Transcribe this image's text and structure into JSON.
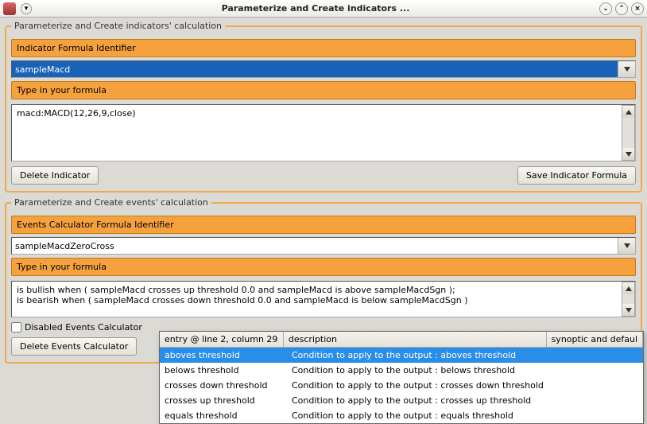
{
  "window": {
    "title": "Parameterize and Create indicators ...",
    "buttons": {
      "min": "⌄",
      "max": "⌃",
      "close": "×"
    }
  },
  "indicators": {
    "legend": "Parameterize and Create indicators' calculation",
    "identifier_label": "Indicator Formula Identifier",
    "identifier_value": "sampleMacd",
    "formula_label": "Type in your formula",
    "formula_value": "macd:MACD(12,26,9,close)",
    "buttons": {
      "delete": "Delete Indicator",
      "save": "Save Indicator Formula"
    }
  },
  "events": {
    "legend": "Parameterize and Create events' calculation",
    "identifier_label": "Events Calculator Formula Identifier",
    "identifier_value": "sampleMacdZeroCross",
    "formula_label": "Type in your formula",
    "formula_value": "is bullish when ( sampleMacd crosses up threshold 0.0 and sampleMacd is above sampleMacdSgn );\nis bearish when ( sampleMacd crosses down threshold 0.0 and sampleMacd is below sampleMacdSgn )",
    "disabled_checkbox": "Disabled Events Calculator",
    "buttons": {
      "delete": "Delete Events Calculator"
    }
  },
  "autocomplete": {
    "header": {
      "c1": "entry @ line 2, column 29",
      "c2": "description",
      "c3": "synoptic and defaul"
    },
    "rows": [
      {
        "entry": "aboves threshold",
        "desc": "Condition to apply to the output : aboves threshold"
      },
      {
        "entry": "belows threshold",
        "desc": "Condition to apply to the output : belows threshold"
      },
      {
        "entry": "crosses down threshold",
        "desc": "Condition to apply to the output : crosses down threshold"
      },
      {
        "entry": "crosses up threshold",
        "desc": "Condition to apply to the output : crosses up threshold"
      },
      {
        "entry": "equals threshold",
        "desc": "Condition to apply to the output : equals threshold"
      }
    ],
    "selected_index": 0
  }
}
